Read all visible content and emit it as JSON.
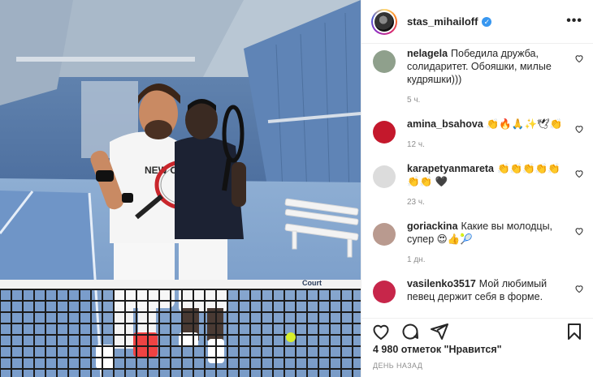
{
  "header": {
    "username": "stas_mihailoff",
    "verified_icon": "verified-badge-icon",
    "more_icon": "more-options-icon",
    "more_label": "•••"
  },
  "comments": [
    {
      "user": "nelagela",
      "text": "Победила дружба, солидаритет. Обояшки, милые кудряшки)))",
      "time": "5 ч.",
      "avatar_color": "#8fa08c"
    },
    {
      "user": "amina_bsahova",
      "text": "👏🔥🙏✨🕊👏",
      "time": "12 ч.",
      "avatar_color": "#c4182c"
    },
    {
      "user": "karapetyanmareta",
      "text": "👏👏👏👏👏👏👏 🖤",
      "time": "23 ч.",
      "avatar_color": "#dcdcdc"
    },
    {
      "user": "goriackina",
      "text": "Какие вы молодцы, супер 😍👍🎾",
      "time": "1 дн.",
      "avatar_color": "#b99a8f"
    },
    {
      "user": "vasilenko3517",
      "text": "Мой любимый певец держит себя в форме.",
      "time": "",
      "avatar_color": "#c7264a"
    }
  ],
  "actions": {
    "like_icon": "heart-icon",
    "comment_icon": "comment-icon",
    "share_icon": "share-icon",
    "save_icon": "bookmark-icon"
  },
  "likes_text": "4 980 отметок \"Нравится\"",
  "date_text": "ДЕНЬ НАЗАД",
  "photo": {
    "jersey_text": "NEW ORL",
    "court_logo": "Court"
  },
  "colors": {
    "accent": "#3897f0",
    "text": "#262626",
    "muted": "#8e8e8e"
  }
}
